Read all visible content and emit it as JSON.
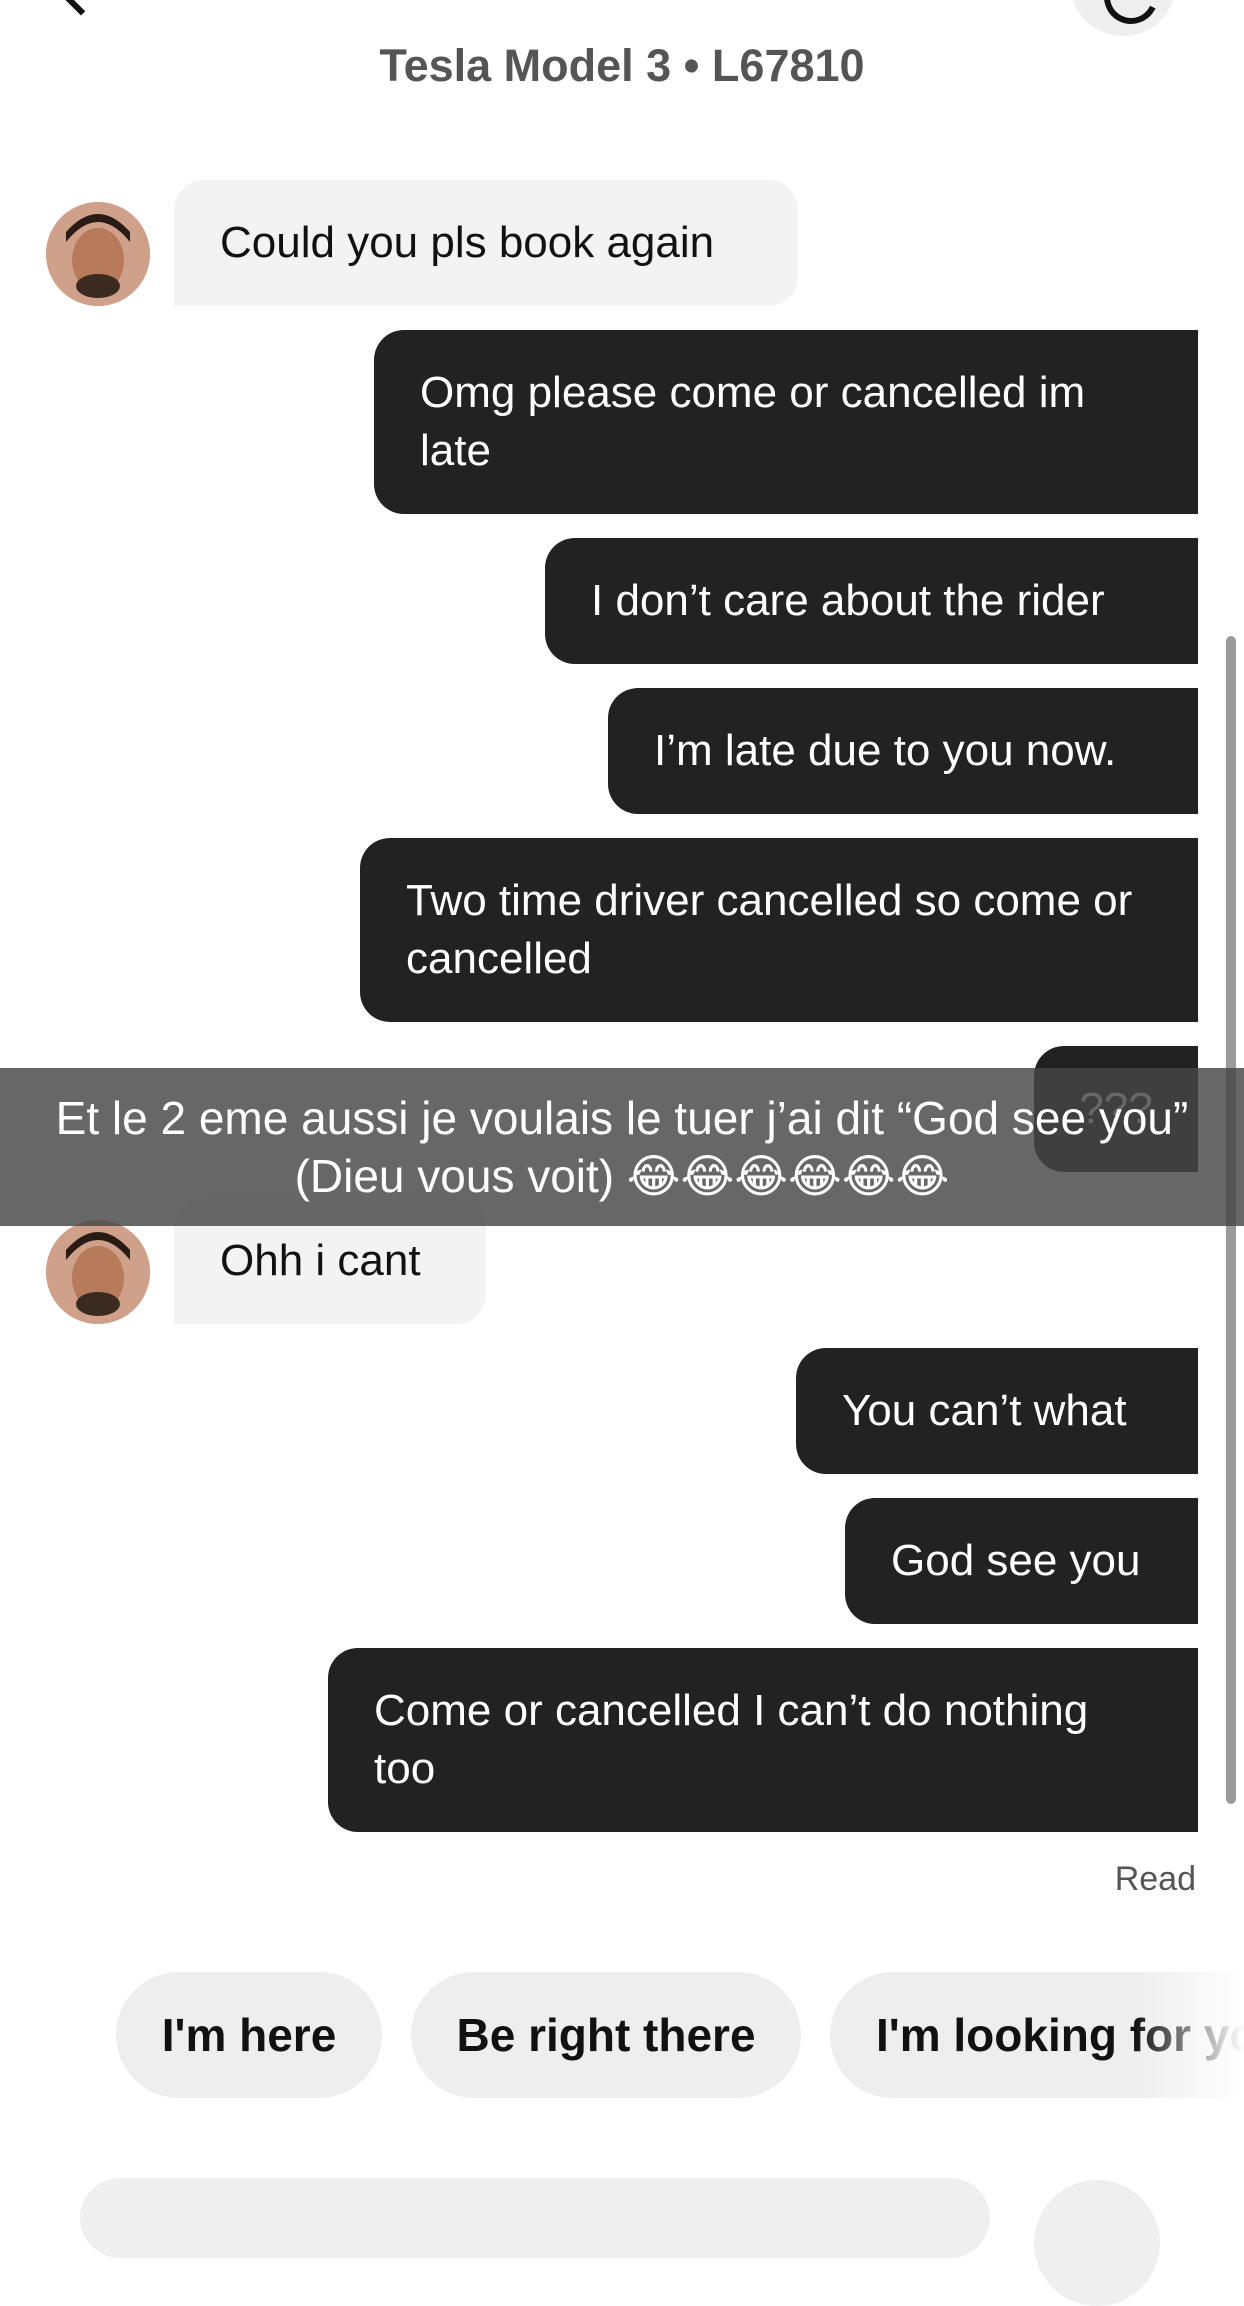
{
  "header": {
    "title": "Tesla Model 3 • L67810",
    "back_icon": "chevron-left-icon",
    "call_icon": "phone-icon"
  },
  "messages": [
    {
      "from": "driver",
      "text": "Could you pls book again"
    },
    {
      "from": "me",
      "text": "Omg please come or cancelled im late"
    },
    {
      "from": "me",
      "text": "I don’t care about the rider"
    },
    {
      "from": "me",
      "text": "I’m late due to you now."
    },
    {
      "from": "me",
      "text": "Two time driver cancelled so come or cancelled"
    },
    {
      "from": "me",
      "text": "???"
    },
    {
      "from": "driver",
      "text": "Ohh i cant"
    },
    {
      "from": "me",
      "text": "You can’t what"
    },
    {
      "from": "me",
      "text": "God see you"
    },
    {
      "from": "me",
      "text": "Come or cancelled I can’t do nothing too"
    }
  ],
  "status": {
    "read": "Read"
  },
  "quick_replies": [
    "I'm here",
    "Be right there",
    "I'm looking for you"
  ],
  "overlay_caption": "Et le 2 eme aussi je voulais le tuer j’ai dit “God see you” (Dieu vous voit) 😂😂😂😂😂😂",
  "colors": {
    "outgoing_bubble": "#222222",
    "incoming_bubble": "#f3f3f3",
    "chip_bg": "#eeeeee"
  }
}
